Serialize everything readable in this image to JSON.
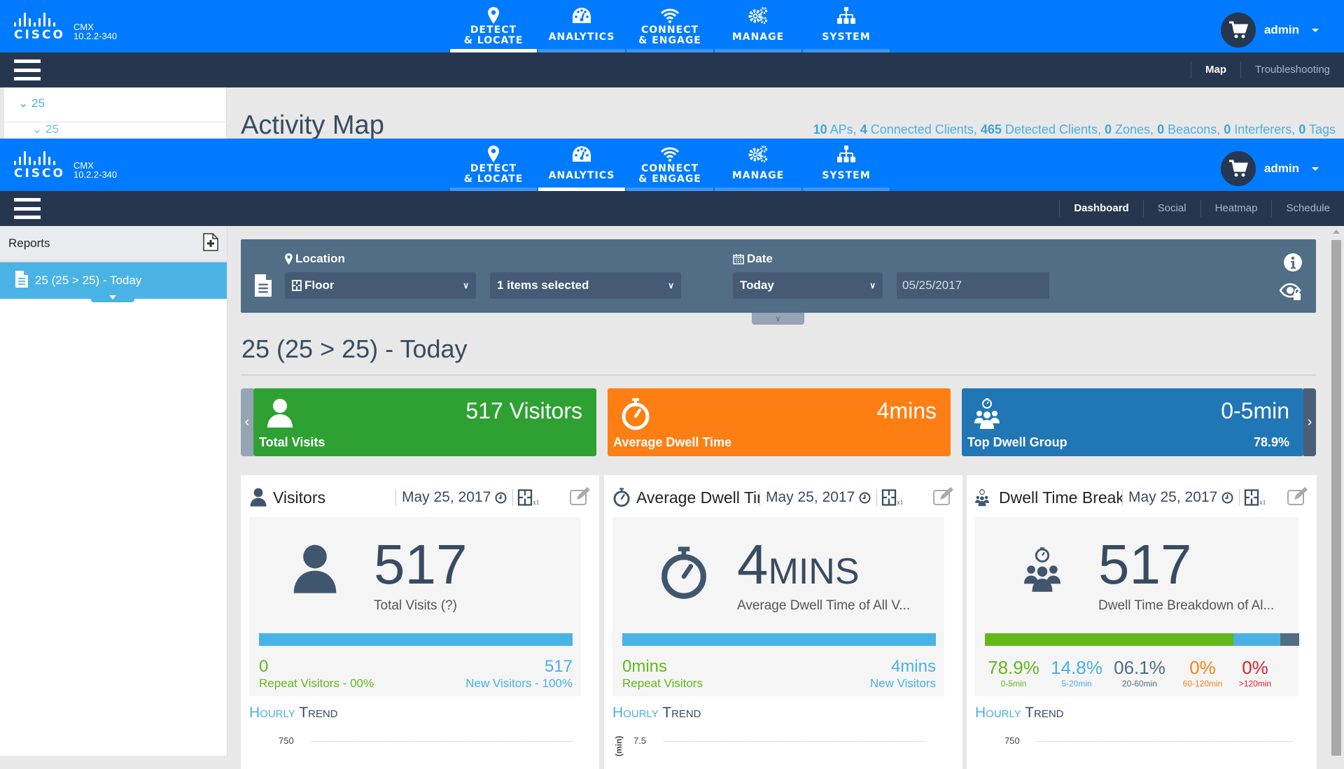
{
  "app": {
    "brand": "CISCO",
    "product": "CMX",
    "version": "10.2.2-340",
    "user": "admin"
  },
  "background_window": {
    "nav": [
      {
        "label1": "DETECT",
        "label2": "& LOCATE",
        "icon": "map-pin-icon",
        "active": true
      },
      {
        "label1": "ANALYTICS",
        "label2": "",
        "icon": "dashboard-gauge-icon",
        "active": false
      },
      {
        "label1": "CONNECT",
        "label2": "& ENGAGE",
        "icon": "wifi-icon",
        "active": false
      },
      {
        "label1": "MANAGE",
        "label2": "",
        "icon": "gears-icon",
        "active": false
      },
      {
        "label1": "SYSTEM",
        "label2": "",
        "icon": "sitemap-icon",
        "active": false
      }
    ],
    "subtabs": [
      {
        "label": "Map",
        "active": true
      },
      {
        "label": "Troubleshooting",
        "active": false
      }
    ],
    "tree_item": "25",
    "tree_child": "25",
    "page_title": "Activity Map",
    "stats": {
      "aps": "10",
      "aps_label": "APs,",
      "connected": "4",
      "connected_label": "Connected Clients,",
      "detected": "465",
      "detected_label": "Detected Clients,",
      "zones": "0",
      "zones_label": "Zones,",
      "beacons": "0",
      "beacons_label": "Beacons,",
      "interferers": "0",
      "interferers_label": "Interferers,",
      "tags": "0",
      "tags_label": "Tags"
    }
  },
  "nav": [
    {
      "label1": "DETECT",
      "label2": "& LOCATE",
      "icon": "map-pin-icon",
      "active": false
    },
    {
      "label1": "ANALYTICS",
      "label2": "",
      "icon": "dashboard-gauge-icon",
      "active": true
    },
    {
      "label1": "CONNECT",
      "label2": "& ENGAGE",
      "icon": "wifi-icon",
      "active": false
    },
    {
      "label1": "MANAGE",
      "label2": "",
      "icon": "gears-icon",
      "active": false
    },
    {
      "label1": "SYSTEM",
      "label2": "",
      "icon": "sitemap-icon",
      "active": false
    }
  ],
  "subtabs": [
    {
      "label": "Dashboard",
      "active": true
    },
    {
      "label": "Social",
      "active": false
    },
    {
      "label": "Heatmap",
      "active": false
    },
    {
      "label": "Schedule",
      "active": false
    }
  ],
  "sidebar": {
    "title": "Reports",
    "items": [
      {
        "label": "25 (25 > 25) - Today",
        "selected": true
      }
    ]
  },
  "filter": {
    "location_label": "Location",
    "location_type": "Floor",
    "location_selection": "1 items selected",
    "date_label": "Date",
    "date_range": "Today",
    "date_value": "05/25/2017"
  },
  "report_title": "25 (25 > 25) - Today",
  "kpis": [
    {
      "label": "Total Visits",
      "value": "517 Visitors",
      "sub": "",
      "color": "#2ea132",
      "icon": "user-icon"
    },
    {
      "label": "Average Dwell Time",
      "value": "4mins",
      "sub": "",
      "color": "#fd7f13",
      "icon": "stopwatch-icon"
    },
    {
      "label": "Top Dwell Group",
      "value": "0-5min",
      "sub": "78.9%",
      "color": "#2176b5",
      "icon": "group-stopwatch-icon"
    }
  ],
  "cards": {
    "visitors": {
      "title": "Visitors",
      "date": "May 25, 2017",
      "floor_badge": "x1",
      "big": "517",
      "caption": "Total Visits (?)",
      "new_fraction": 1.0,
      "left_value": "0",
      "left_label": "Repeat Visitors - 00%",
      "right_value": "517",
      "right_label": "New Visitors - 100%",
      "trend_first": "H",
      "trend_rest1": "OURLY ",
      "trend_second": "T",
      "trend_rest2": "REND",
      "ytick": "750"
    },
    "dwell": {
      "title": "Average Dwell Time",
      "date": "May 25, 2017",
      "floor_badge": "x1",
      "big": "4",
      "big_unit": "MINS",
      "caption": "Average Dwell Time of All V...",
      "new_fraction": 1.0,
      "left_value": "0mins",
      "left_label": "Repeat Visitors",
      "right_value": "4mins",
      "right_label": "New Visitors",
      "ytick": "7.5",
      "yunit": "(min)"
    },
    "breakdown": {
      "title": "Dwell Time Breakdown",
      "date": "May 25, 2017",
      "floor_badge": "x1",
      "big": "517",
      "caption": "Dwell Time Breakdown of Al...",
      "segments": [
        {
          "pct": "78.9%",
          "range": "0-5min",
          "value": 78.9,
          "color": "#63b81b"
        },
        {
          "pct": "14.8%",
          "range": "5-20min",
          "value": 14.8,
          "color": "#4ab0e6"
        },
        {
          "pct": "06.1%",
          "range": "20-60min",
          "value": 6.1,
          "color": "#526d86"
        },
        {
          "pct": "0%",
          "range": "60-120min",
          "value": 0,
          "color": "#fd7f13"
        },
        {
          "pct": "0%",
          "range": ">120min",
          "value": 0,
          "color": "#d7232d"
        }
      ],
      "ytick": "750"
    }
  }
}
